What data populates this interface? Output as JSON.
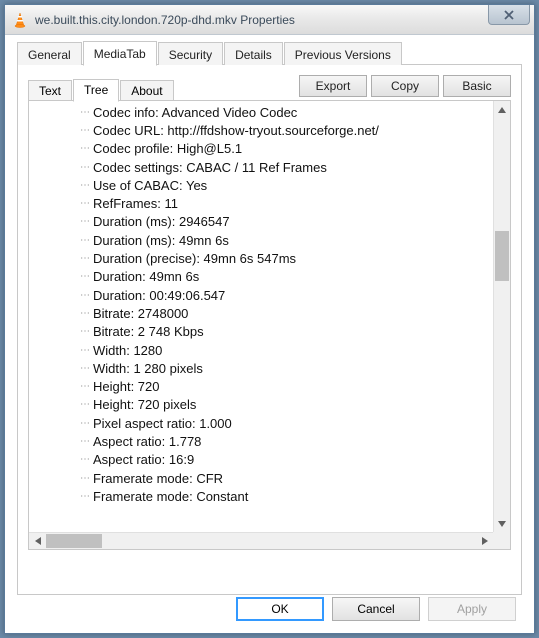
{
  "window": {
    "title": "we.built.this.city.london.720p-dhd.mkv Properties"
  },
  "main_tabs": [
    {
      "label": "General"
    },
    {
      "label": "MediaTab"
    },
    {
      "label": "Security"
    },
    {
      "label": "Details"
    },
    {
      "label": "Previous Versions"
    }
  ],
  "sub_tabs": [
    {
      "label": "Text"
    },
    {
      "label": "Tree"
    },
    {
      "label": "About"
    }
  ],
  "action_buttons": {
    "export": "Export",
    "copy": "Copy",
    "basic": "Basic"
  },
  "tree_items": [
    "Codec info: Advanced Video Codec",
    "Codec URL: http://ffdshow-tryout.sourceforge.net/",
    "Codec profile: High@L5.1",
    "Codec settings: CABAC / 11 Ref Frames",
    "Use of CABAC: Yes",
    "RefFrames: 11",
    "Duration (ms): 2946547",
    "Duration (ms): 49mn 6s",
    "Duration (precise): 49mn 6s 547ms",
    "Duration: 49mn 6s",
    "Duration: 00:49:06.547",
    "Bitrate: 2748000",
    "Bitrate: 2 748 Kbps",
    "Width: 1280",
    "Width: 1 280 pixels",
    "Height: 720",
    "Height: 720 pixels",
    "Pixel aspect ratio: 1.000",
    "Aspect ratio: 1.778",
    "Aspect ratio: 16:9",
    "Framerate mode: CFR",
    "Framerate mode: Constant"
  ],
  "bottom_buttons": {
    "ok": "OK",
    "cancel": "Cancel",
    "apply": "Apply"
  }
}
